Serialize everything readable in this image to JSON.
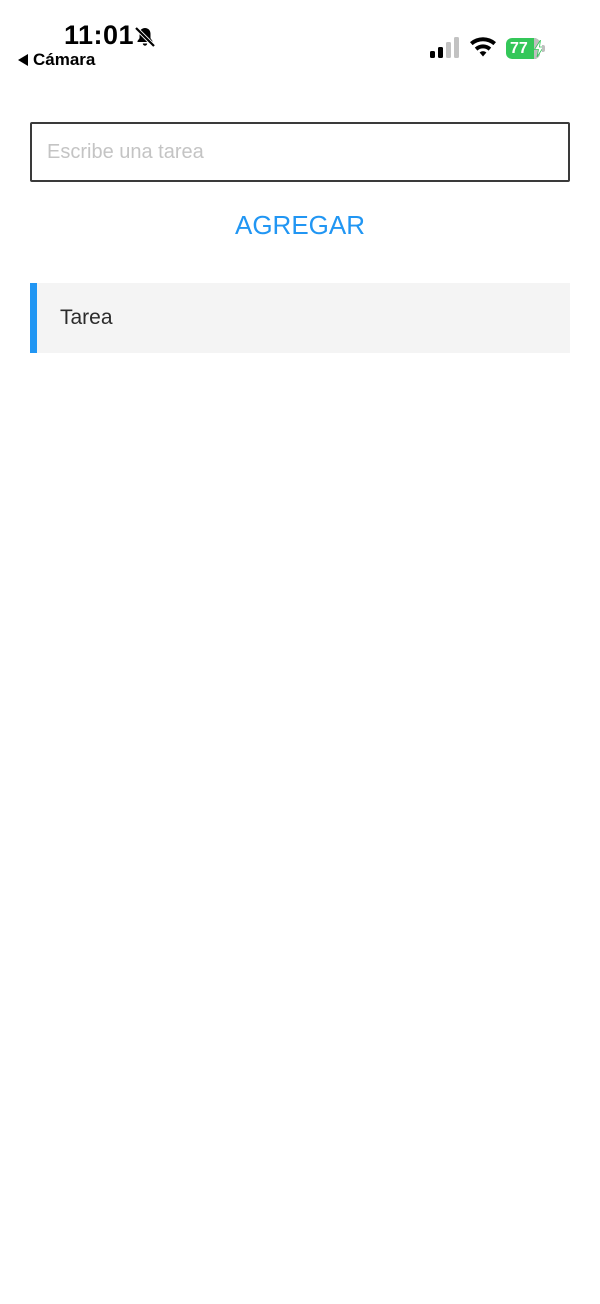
{
  "status_bar": {
    "time": "11:01",
    "back_label": "Cámara",
    "battery_level": "77",
    "battery_color": "#34c759",
    "icons": [
      "bell-slash-icon",
      "back-arrow-icon",
      "signal-icon",
      "wifi-icon",
      "battery-icon",
      "bolt-icon"
    ]
  },
  "form": {
    "input_placeholder": "Escribe una tarea",
    "input_value": "",
    "add_label": "AGREGAR"
  },
  "tasks": [
    {
      "label": "Tarea"
    }
  ],
  "colors": {
    "accent": "#2196f3",
    "item_background": "#f4f4f4",
    "placeholder": "#c4c4c4"
  }
}
